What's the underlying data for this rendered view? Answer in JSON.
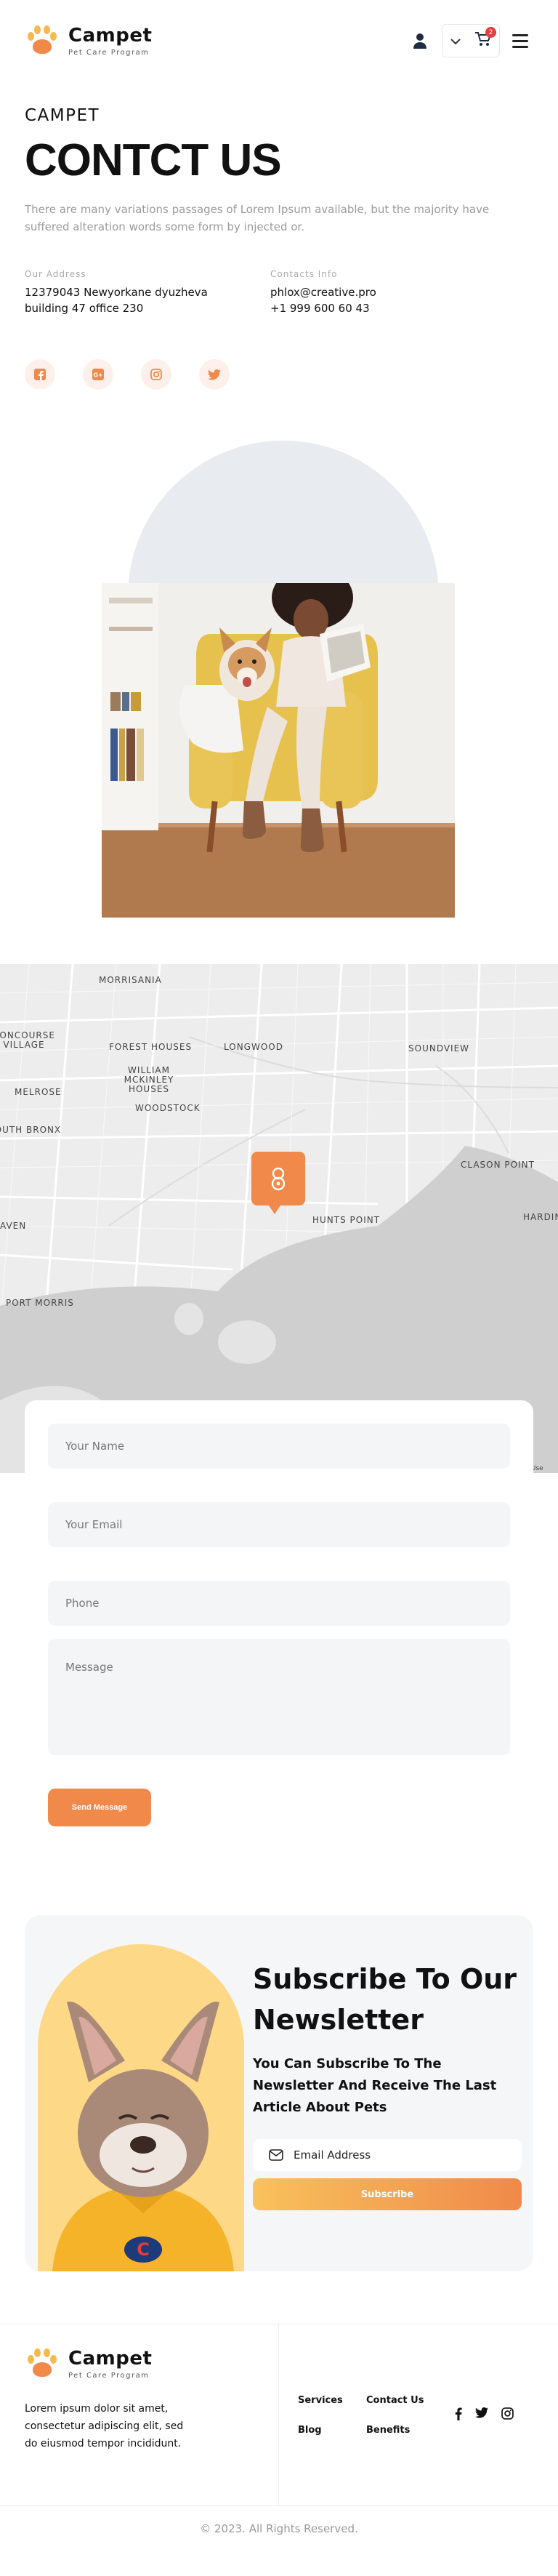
{
  "header": {
    "brand": "Campet",
    "tagline": "Pet Care Program",
    "cart_count": "2"
  },
  "hero": {
    "eyebrow": "CAMPET",
    "title": "CONTCT US",
    "description": "There are many variations passages of Lorem Ipsum available, but the majority have suffered alteration words some form by injected or."
  },
  "info": {
    "address_label": "Our Address",
    "address_line1": "12379043 Newyorkane dyuzheva",
    "address_line2": "building 47 office 230",
    "contacts_label": "Contacts Info",
    "email": "phlox@creative.pro",
    "phone": "+1 999 600 60 43"
  },
  "socials": [
    "facebook-icon",
    "google-plus-icon",
    "instagram-icon",
    "twitter-icon"
  ],
  "map": {
    "labels": [
      "MORRISANIA",
      "CONCOURSE VILLAGE",
      "FOREST HOUSES",
      "LONGWOOD",
      "SOUNDVIEW",
      "MELROSE",
      "WILLIAM MCKINLEY HOUSES",
      "WOODSTOCK",
      "SOUTH BRONX",
      "CLASON POINT",
      "HUNTS POINT",
      "HARDING",
      "HAVEN",
      "PORT MORRIS"
    ],
    "terms": "Terms of Use"
  },
  "form": {
    "name_placeholder": "Your Name",
    "email_placeholder": "Your Email",
    "phone_placeholder": "Phone",
    "message_placeholder": "Message",
    "submit_label": "Send Message"
  },
  "newsletter": {
    "title": "Subscribe To Our Newsletter",
    "subtitle": "You Can Subscribe To The Newsletter And Receive The Last Article About Pets",
    "email_placeholder": "Email Address",
    "button_label": "Subscribe"
  },
  "footer": {
    "brand": "Campet",
    "tagline": "Pet Care Program",
    "description": "Lorem ipsum dolor sit amet, consectetur adipiscing elit, sed do eiusmod tempor incididunt.",
    "links": [
      "Services",
      "Contact Us",
      "Blog",
      "Benefits"
    ],
    "copyright": "© 2023. All Rights Reserved."
  },
  "colors": {
    "accent": "#f0894a",
    "accent_light": "#f8c25c",
    "badge": "#e43d3d"
  }
}
